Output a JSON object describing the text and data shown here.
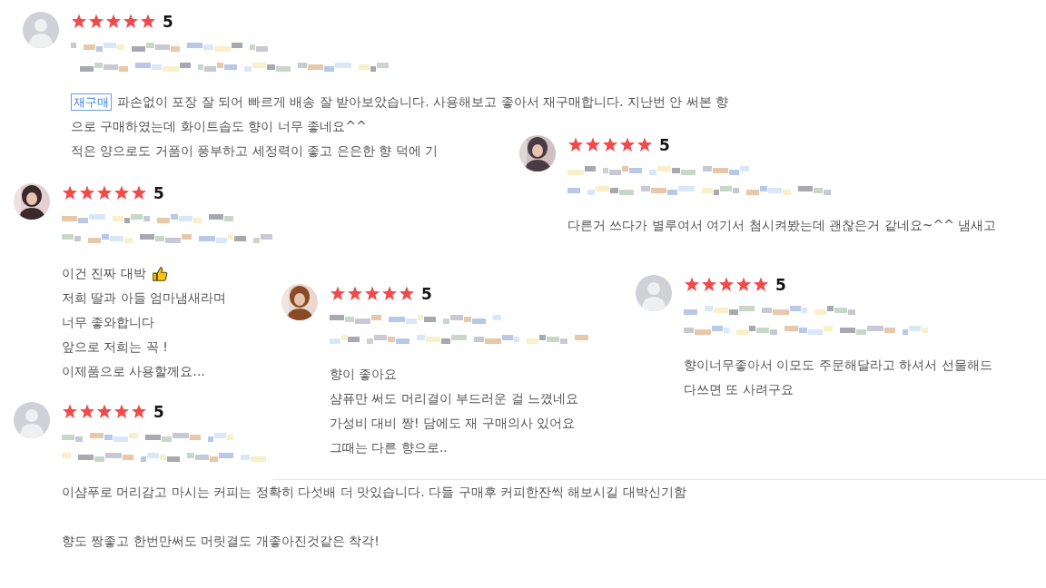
{
  "reviews": [
    {
      "photo_avatar": false,
      "stars": 5,
      "score": "5",
      "tag": "재구매",
      "paragraphs": [
        [
          {
            "text": "파손없이 포장 잘 되어 빠르게 배송 잘 받아보았습니다. 사용해보고 좋아서 재구매합니다. 지난번 안 써본 향"
          },
          {
            "text": "으로 구매하였는데 화이트솝도 향이 너무 좋네요^^"
          },
          {
            "text": "적은 양으로도 거품이 풍부하고 세정력이 좋고 은은한 향 덕에 기"
          }
        ]
      ]
    },
    {
      "photo_avatar": true,
      "stars": 5,
      "score": "5",
      "paragraphs": [
        [
          {
            "text": "다른거 쓰다가 별루여서 여기서 첨시켜봤는데 괜찮은거 같네요~^^ 냄새고"
          }
        ]
      ]
    },
    {
      "photo_avatar": true,
      "stars": 5,
      "score": "5",
      "paragraphs": [
        [
          {
            "text": "이건 진짜 대박",
            "thumb": true
          },
          {
            "text": "저희 딸과 아들 엄마냄새라며"
          },
          {
            "text": "너무 좋와합니다"
          },
          {
            "text": "앞으로 저희는 꼭 !"
          },
          {
            "text": "이제품으로 사용할께요..."
          }
        ]
      ]
    },
    {
      "photo_avatar": true,
      "stars": 5,
      "score": "5",
      "paragraphs": [
        [
          {
            "text": "향이 좋아요"
          },
          {
            "text": "샴퓨만 써도 머리결이 부드러운 걸 느꼈네요"
          },
          {
            "text": "가성비 대비 짱!  담에도 재 구매의사 있어요"
          },
          {
            "text": "그때는 다른 향으로.."
          }
        ]
      ]
    },
    {
      "photo_avatar": false,
      "stars": 5,
      "score": "5",
      "paragraphs": [
        [
          {
            "text": "향이너무좋아서 이모도 주문해달라고 하셔서 선물해드"
          },
          {
            "text": "다쓰면 또 사려구요"
          }
        ]
      ]
    },
    {
      "photo_avatar": false,
      "stars": 5,
      "score": "5",
      "paragraphs": [
        [
          {
            "text": "이샴푸로 머리감고 마시는 커피는 정확히 다섯배 더 맛있습니다. 다들 구매후 커피한잔씩 해보시길 대박신기함"
          }
        ],
        [
          {
            "text": "향도 짱좋고 한번만써도 머릿결도 개좋아진것같은 착각!"
          }
        ]
      ]
    }
  ]
}
